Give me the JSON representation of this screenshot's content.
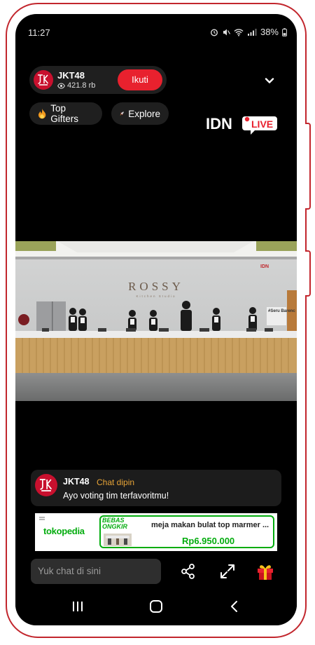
{
  "status_bar": {
    "time": "11:27",
    "battery": "38%"
  },
  "channel": {
    "name": "JKT48",
    "avatar_text": "JKT48",
    "viewers": "421.8 rb",
    "follow_label": "Ikuti"
  },
  "chips": [
    {
      "label": "Top Gifters",
      "icon": "flame-icon"
    },
    {
      "label": "Explore",
      "icon": "rocket-icon"
    }
  ],
  "brand": {
    "idn": "IDN",
    "live": "LIVE"
  },
  "video": {
    "sign": "ROSSY",
    "sign_sub": "Kitchen Studio",
    "overlay_text": "#Seru Barenc"
  },
  "chat": {
    "user": "JKT48",
    "tag": "Chat dipin",
    "message": "Ayo voting tim terfavoritmu!"
  },
  "ad": {
    "brand": "tokopedia",
    "badge_line1": "BEBAS",
    "badge_line2": "ONGKIR",
    "title": "meja makan bulat top marmer ...",
    "price": "Rp6.950.000"
  },
  "chat_input": {
    "placeholder": "Yuk chat di sini"
  },
  "colors": {
    "accent": "#e8212e",
    "frame": "#c2262d",
    "ad_green": "#03ac0e",
    "chat_tag": "#e7a437"
  }
}
